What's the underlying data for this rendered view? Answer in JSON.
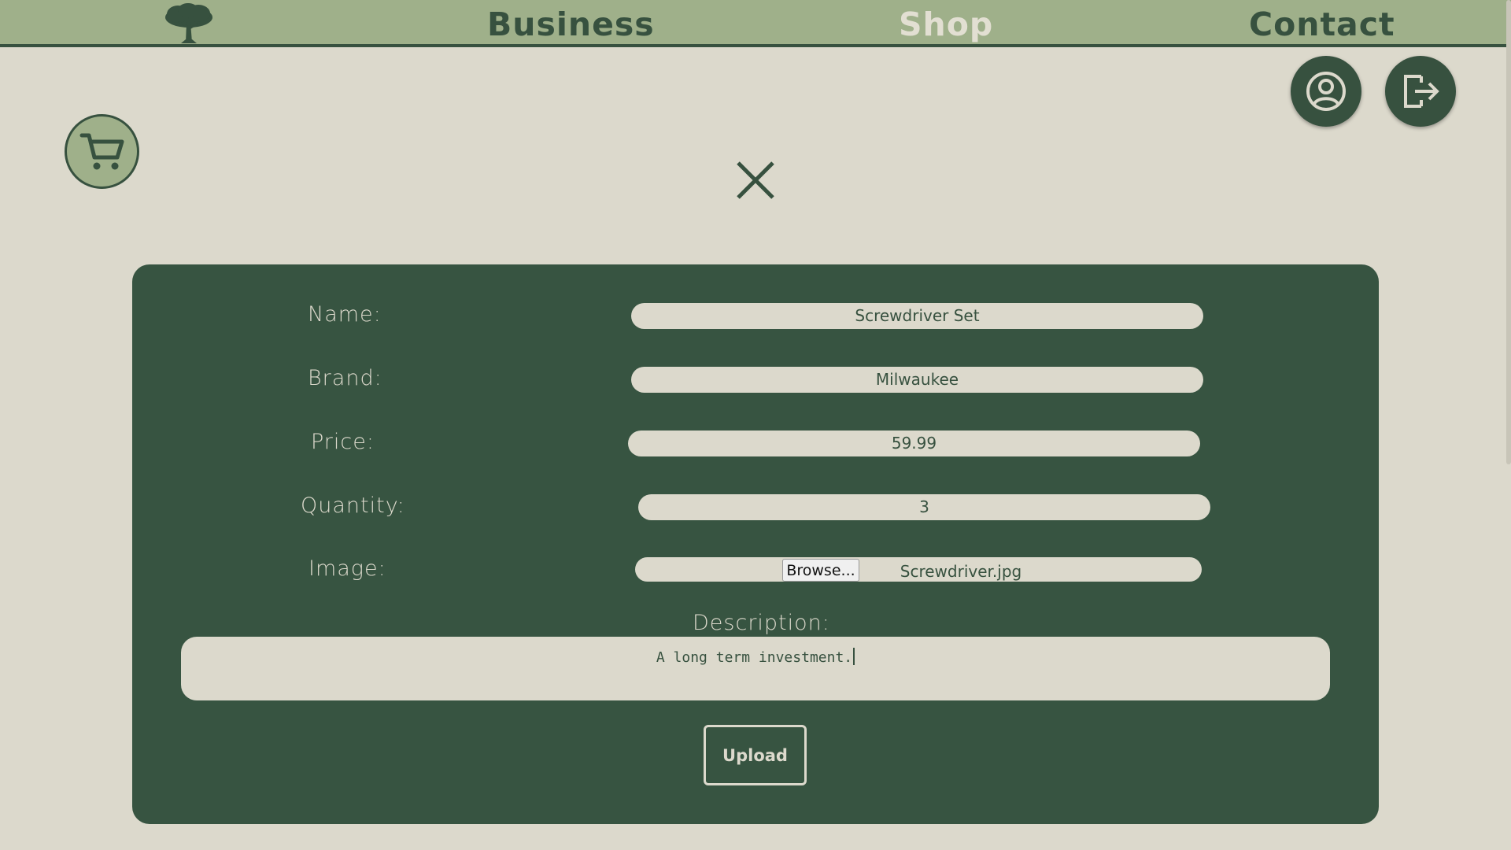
{
  "nav": {
    "logo_icon": "tree-icon",
    "links": [
      {
        "label": "Business",
        "active": false
      },
      {
        "label": "Shop",
        "active": true
      },
      {
        "label": "Contact",
        "active": false
      }
    ]
  },
  "actions": {
    "profile_icon": "user-circle-icon",
    "logout_icon": "logout-icon",
    "cart_icon": "shopping-cart-icon",
    "close_icon": "close-icon"
  },
  "form": {
    "name_label": "Name:",
    "name_value": "Screwdriver Set",
    "brand_label": "Brand:",
    "brand_value": "Milwaukee",
    "price_label": "Price:",
    "price_value": "59.99",
    "quantity_label": "Quantity:",
    "quantity_value": "3",
    "image_label": "Image:",
    "browse_label": "Browse...",
    "image_file": "Screwdriver.jpg",
    "description_label": "Description:",
    "description_value": "A long term investment.",
    "upload_label": "Upload"
  },
  "colors": {
    "dark_green": "#37513f",
    "sage": "#9fb08a",
    "background": "#dcd9cc"
  }
}
